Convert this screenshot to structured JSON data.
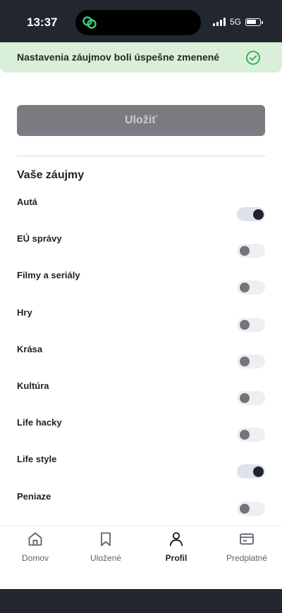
{
  "status_bar": {
    "time": "13:37",
    "network": "5G",
    "icons": [
      "link-icon",
      "signal-icon",
      "battery-charging-icon"
    ]
  },
  "toast": {
    "message": "Nastavenia záujmov boli úspešne zmenené",
    "icon": "check-circle-icon",
    "color": "#d9efd9"
  },
  "save_button": {
    "label": "Uložiť",
    "enabled": false
  },
  "interests": {
    "title": "Vaše záujmy",
    "items": [
      {
        "label": "Autá",
        "enabled": true
      },
      {
        "label": "EÚ správy",
        "enabled": false
      },
      {
        "label": "Filmy a seriály",
        "enabled": false
      },
      {
        "label": "Hry",
        "enabled": false
      },
      {
        "label": "Krása",
        "enabled": false
      },
      {
        "label": "Kultúra",
        "enabled": false
      },
      {
        "label": "Life hacky",
        "enabled": false
      },
      {
        "label": "Life style",
        "enabled": true
      },
      {
        "label": "Peniaze",
        "enabled": false
      }
    ]
  },
  "tab_bar": {
    "tabs": [
      {
        "label": "Domov",
        "icon": "home-icon",
        "active": false
      },
      {
        "label": "Uložené",
        "icon": "bookmark-icon",
        "active": false
      },
      {
        "label": "Profil",
        "icon": "person-icon",
        "active": true
      },
      {
        "label": "Predplatné",
        "icon": "card-icon",
        "active": false
      }
    ]
  },
  "colors": {
    "accent_dark": "#1f2430",
    "success": "#2fa84f",
    "button_disabled": "#7b7c82"
  }
}
